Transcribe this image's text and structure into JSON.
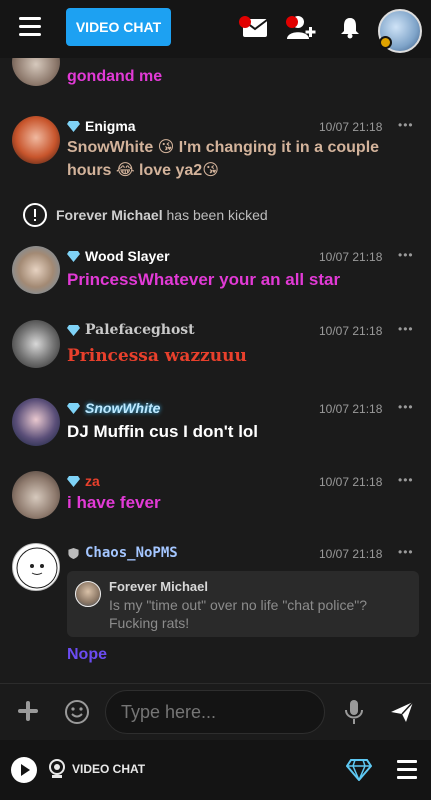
{
  "header": {
    "video_chat_label": "VIDEO CHAT",
    "icons": [
      "menu-icon",
      "mail-icon",
      "add-friend-icon",
      "bell-icon"
    ]
  },
  "colors": {
    "accent": "#1da1f2",
    "notification": "#e10000",
    "gem": "#7fd3f7",
    "magenta": "#e23ad6",
    "tan": "#d3b39b",
    "red_text": "#e8402c",
    "purple": "#6b4cf2"
  },
  "messages": [
    {
      "id": "m0",
      "name": "",
      "time": "",
      "text": "gondand me",
      "text_color": "#e23ad6"
    },
    {
      "id": "m1",
      "name": "Enigma",
      "name_color": "#ffffff",
      "time": "10/07 21:18",
      "text": "SnowWhite 😘 I'm changing it in a couple hours 😂 love ya2😘",
      "text_color": "#d3b39b"
    },
    {
      "id": "sys",
      "system": true,
      "user": "Forever Michael",
      "action": "has been kicked"
    },
    {
      "id": "m2",
      "name": "Wood Slayer",
      "name_color": "#ffffff",
      "time": "10/07 21:18",
      "text": "PrincessWhatever your an all star",
      "text_color": "#e23ad6"
    },
    {
      "id": "m3",
      "name": "Palefaceghost",
      "name_color": "#c9c9c9",
      "time": "10/07 21:18",
      "text": "Princessa wazzuuu",
      "text_color": "#e8402c"
    },
    {
      "id": "m4",
      "name": "SnowWhite",
      "name_color": "#bde9ff",
      "time": "10/07 21:18",
      "text": "DJ Muffin cus I don't lol",
      "text_color": "#ffffff"
    },
    {
      "id": "m5",
      "name": "za",
      "name_color": "#e8402c",
      "time": "10/07 21:18",
      "text": "i have fever",
      "text_color": "#e23ad6"
    },
    {
      "id": "m6",
      "name": "Chaos_NoPMS",
      "name_color": "#a4c6ff",
      "time": "10/07 21:18",
      "quote": {
        "name": "Forever Michael",
        "text": "Is my \"time out\" over no life \"chat police\"? Fucking rats!"
      },
      "text": "Nope",
      "text_color": "#6b4cf2"
    }
  ],
  "composer": {
    "placeholder": "Type here..."
  },
  "bottombar": {
    "video_chat_label": "VIDEO CHAT"
  }
}
